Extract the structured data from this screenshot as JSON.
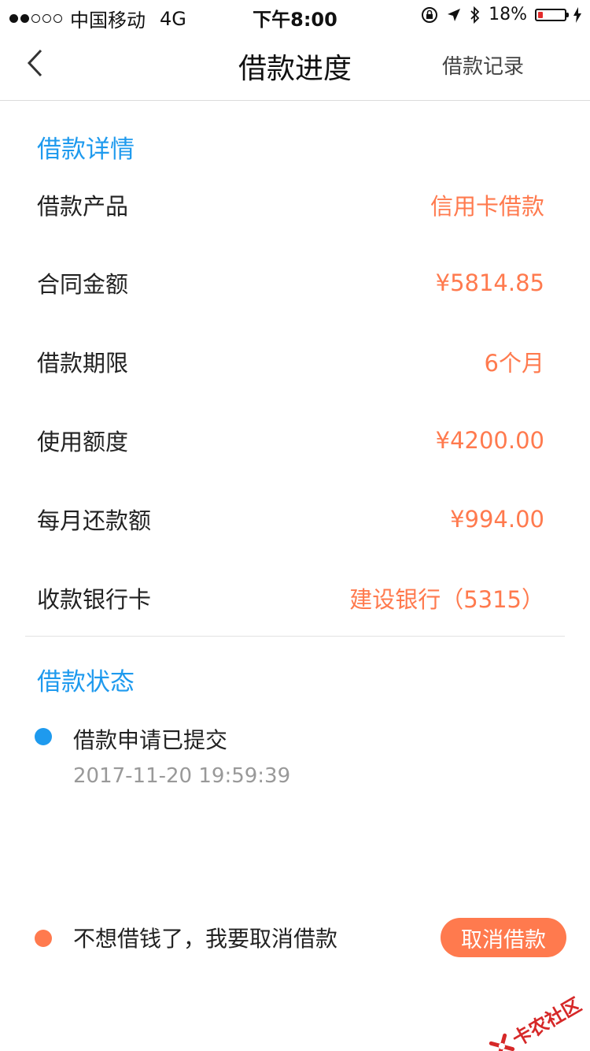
{
  "status_bar": {
    "carrier": "中国移动",
    "network": "4G",
    "time": "下午8:00",
    "battery_percent": "18%",
    "battery_level": 0.18
  },
  "nav": {
    "title": "借款进度",
    "right_link": "借款记录"
  },
  "details": {
    "section_title": "借款详情",
    "rows": [
      {
        "label": "借款产品",
        "value": "信用卡借款"
      },
      {
        "label": "合同金额",
        "value": "¥5814.85"
      },
      {
        "label": "借款期限",
        "value": "6个月"
      },
      {
        "label": "使用额度",
        "value": "¥4200.00"
      },
      {
        "label": "每月还款额",
        "value": "¥994.00"
      },
      {
        "label": "收款银行卡",
        "value": "建设银行（5315）"
      }
    ]
  },
  "status": {
    "section_title": "借款状态",
    "items": [
      {
        "text": "借款申请已提交",
        "time": "2017-11-20 19:59:39"
      }
    ]
  },
  "cancel": {
    "prompt": "不想借钱了，我要取消借款",
    "button_label": "取消借款"
  },
  "watermark": {
    "text": "卡农社区"
  },
  "colors": {
    "accent_blue": "#1e9aee",
    "accent_orange": "#ff7a4e"
  }
}
